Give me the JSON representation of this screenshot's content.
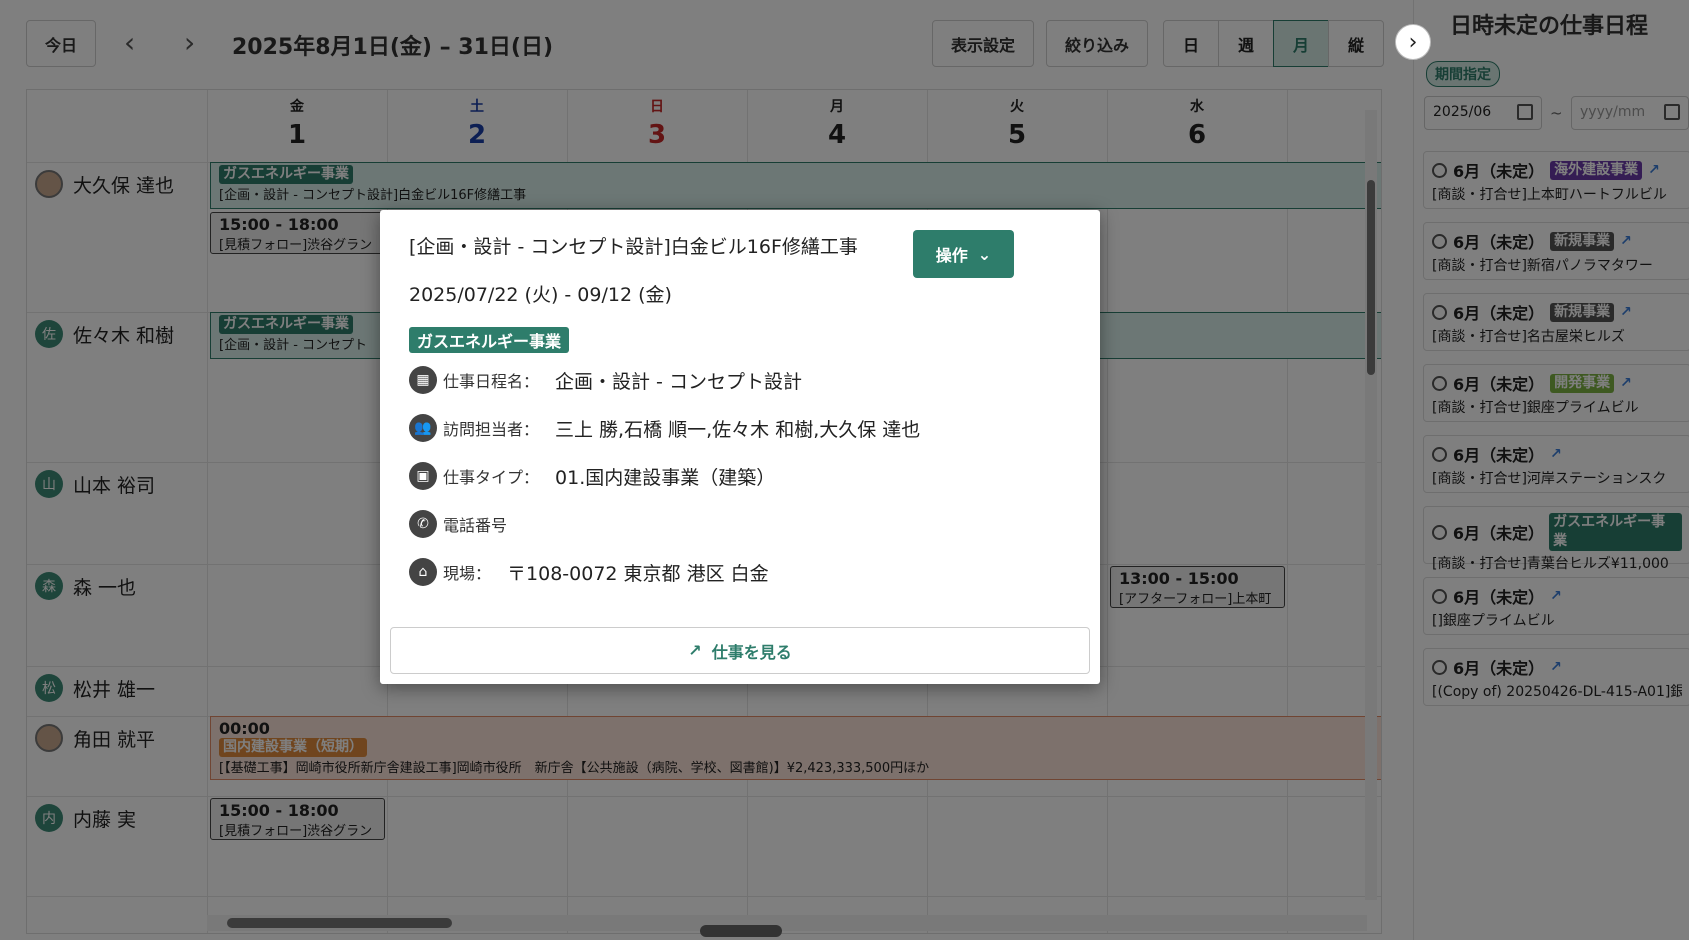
{
  "toolbar": {
    "today": "今日",
    "prev": "‹",
    "next": "›",
    "range": "2025年8月1日(金) – 31日(日)",
    "display_settings": "表示設定",
    "filter": "絞り込み",
    "views": [
      "日",
      "週",
      "月",
      "縦"
    ],
    "active_view": "月",
    "collapse": "›"
  },
  "colors": {
    "accent": "#2e7d6b",
    "saturday": "#1a3fa8",
    "sunday": "#c62828",
    "purple": "#6a3aa8"
  },
  "days": [
    {
      "dow": "金",
      "num": "1"
    },
    {
      "dow": "土",
      "num": "2"
    },
    {
      "dow": "日",
      "num": "3"
    },
    {
      "dow": "月",
      "num": "4"
    },
    {
      "dow": "火",
      "num": "5"
    },
    {
      "dow": "水",
      "num": "6"
    }
  ],
  "people": [
    "大久保 達也",
    "佐々木 和樹",
    "山本 裕司",
    "森 一也",
    "松井 雄一",
    "角田 就平",
    "内藤 実"
  ],
  "avatar_initials": [
    "佐",
    "山",
    "森",
    "松",
    "内"
  ],
  "events": {
    "ohkubo_tag": "ガスエネルギー事業",
    "ohkubo_title": "[企画・設計 - コンセプト設計]白金ビル16F修繕工事",
    "ohkubo_time": "15:00 - 18:00",
    "ohkubo_sub": "[見積フォロー]渋谷グラン",
    "sasaki_tag": "ガスエネルギー事業",
    "sasaki_title": "[企画・設計 - コンセプト",
    "mori_time": "13:00 - 15:00",
    "mori_sub": "[アフターフォロー]上本町",
    "tsunoda_time": "00:00",
    "tsunoda_tag": "国内建設事業（短期）",
    "tsunoda_title": "[【基礎工事】岡崎市役所新庁舎建設工事]岡崎市役所　新庁舎【公共施設（病院、学校、図書館)】¥2,423,333,500円ほか",
    "naito_time": "15:00 - 18:00",
    "naito_sub": "[見積フォロー]渋谷グラン"
  },
  "modal": {
    "title": "[企画・設計 - コンセプト設計]白金ビル16F修繕工事",
    "dates": "2025/07/22 (火) - 09/12 (金)",
    "tag": "ガスエネルギー事業",
    "action": "操作",
    "rows": [
      {
        "label": "仕事日程名：",
        "value": "企画・設計 - コンセプト設計"
      },
      {
        "label": "訪問担当者：",
        "value": "三上 勝,石橋 順一,佐々木 和樹,大久保 達也"
      },
      {
        "label": "仕事タイプ：",
        "value": "01.国内建設事業（建築）"
      },
      {
        "label": "電話番号",
        "value": ""
      },
      {
        "label": "現場：",
        "value": "〒108-0072 東京都 港区 白金"
      }
    ],
    "view_job": "仕事を見る"
  },
  "sidebar": {
    "title": "日時未定の仕事日程",
    "period_badge": "期間指定",
    "date_from": "2025/06",
    "date_to_placeholder": "yyyy/mm",
    "tilde": "~",
    "cards": [
      {
        "month": "6月（未定）",
        "tag": "海外建設事業",
        "tag_color": "#6a3aa8",
        "desc": "[商談・打合せ]上本町ハートフルビル"
      },
      {
        "month": "6月（未定）",
        "tag": "新規事業",
        "tag_color": "#555555",
        "desc": "[商談・打合せ]新宿パノラマタワー"
      },
      {
        "month": "6月（未定）",
        "tag": "新規事業",
        "tag_color": "#555555",
        "desc": "[商談・打合せ]名古屋栄ヒルズ"
      },
      {
        "month": "6月（未定）",
        "tag": "開発事業",
        "tag_color": "#7cb342",
        "desc": "[商談・打合せ]銀座プライムビル"
      },
      {
        "month": "6月（未定）",
        "tag": "",
        "tag_color": "",
        "desc": "[商談・打合せ]河岸ステーションスク"
      },
      {
        "month": "6月（未定）",
        "tag": "ガスエネルギー事業",
        "tag_color": "#2e7d6b",
        "desc": "[商談・打合せ]青葉台ヒルズ¥11,000"
      },
      {
        "month": "6月（未定）",
        "tag": "",
        "tag_color": "",
        "desc": "[]銀座プライムビル"
      },
      {
        "month": "6月（未定）",
        "tag": "",
        "tag_color": "",
        "desc": "[(Copy of) 20250426-DL-415-A01]銀"
      }
    ]
  }
}
